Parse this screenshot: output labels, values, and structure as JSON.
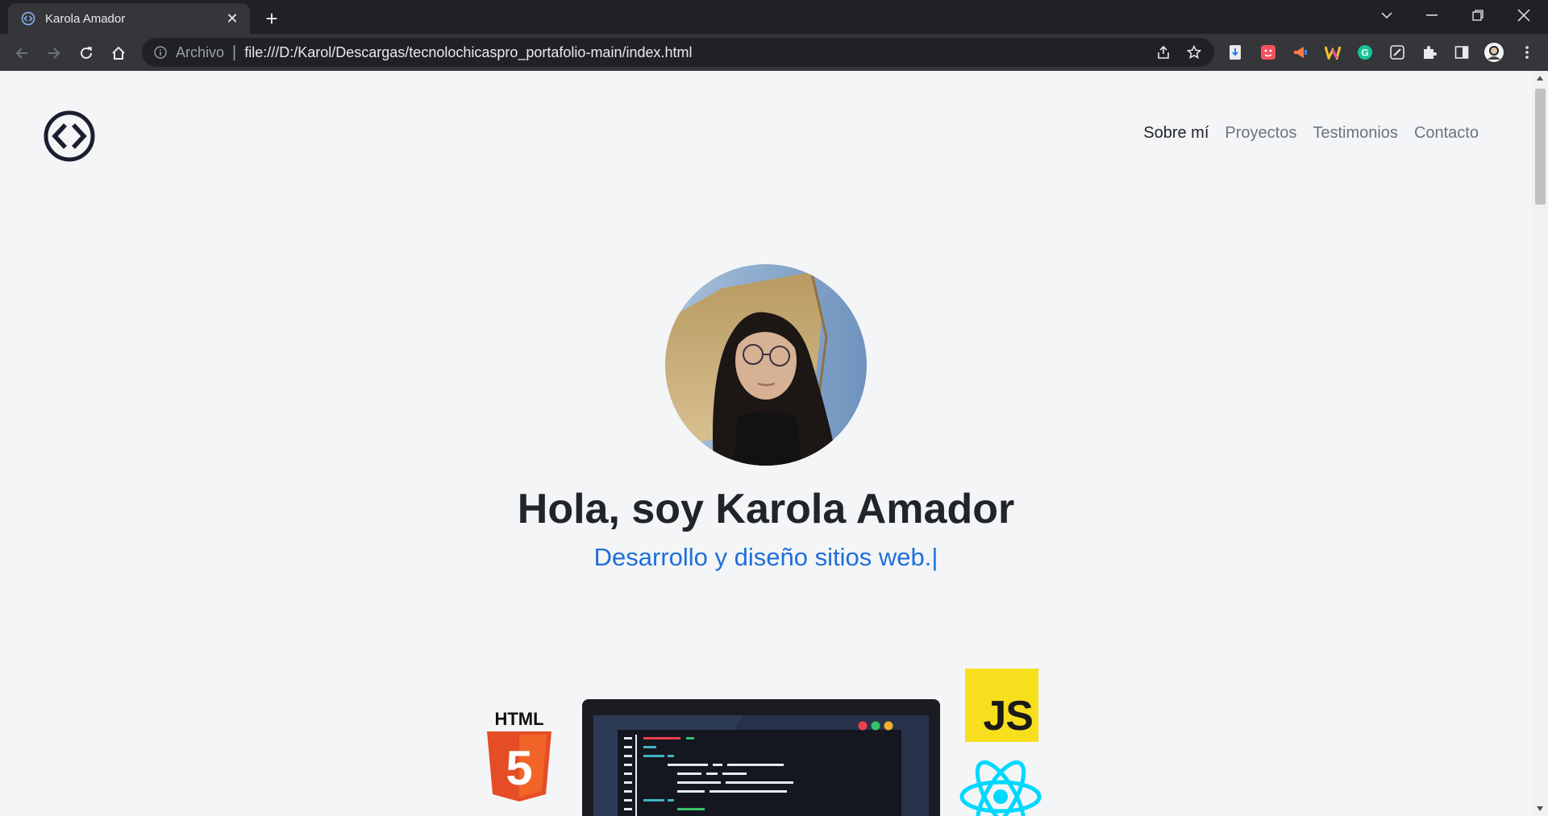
{
  "browser": {
    "tab_title": "Karola Amador",
    "url_scheme_label": "Archivo",
    "url": "file:///D:/Karol/Descargas/tecnolochicaspro_portafolio-main/index.html",
    "extensions": [
      "save-to-drive-icon",
      "tomato-timer-icon",
      "megaphone-icon",
      "w-extension-icon",
      "grammarly-icon",
      "edit-icon"
    ]
  },
  "header": {
    "nav_items": [
      {
        "label": "Sobre mí",
        "active": true
      },
      {
        "label": "Proyectos",
        "active": false
      },
      {
        "label": "Testimonios",
        "active": false
      },
      {
        "label": "Contacto",
        "active": false
      }
    ]
  },
  "hero": {
    "title": "Hola, soy Karola Amador",
    "subtitle": "Desarrollo y diseño sitios web.",
    "cursor": "|"
  },
  "tech": {
    "html_label": "HTML",
    "html_number": "5",
    "js_label": "JS"
  },
  "colors": {
    "accent": "#1f6fd9",
    "background": "#f4f5f7",
    "html5": "#e44d26",
    "js": "#f7df1e",
    "react": "#00d8ff"
  }
}
